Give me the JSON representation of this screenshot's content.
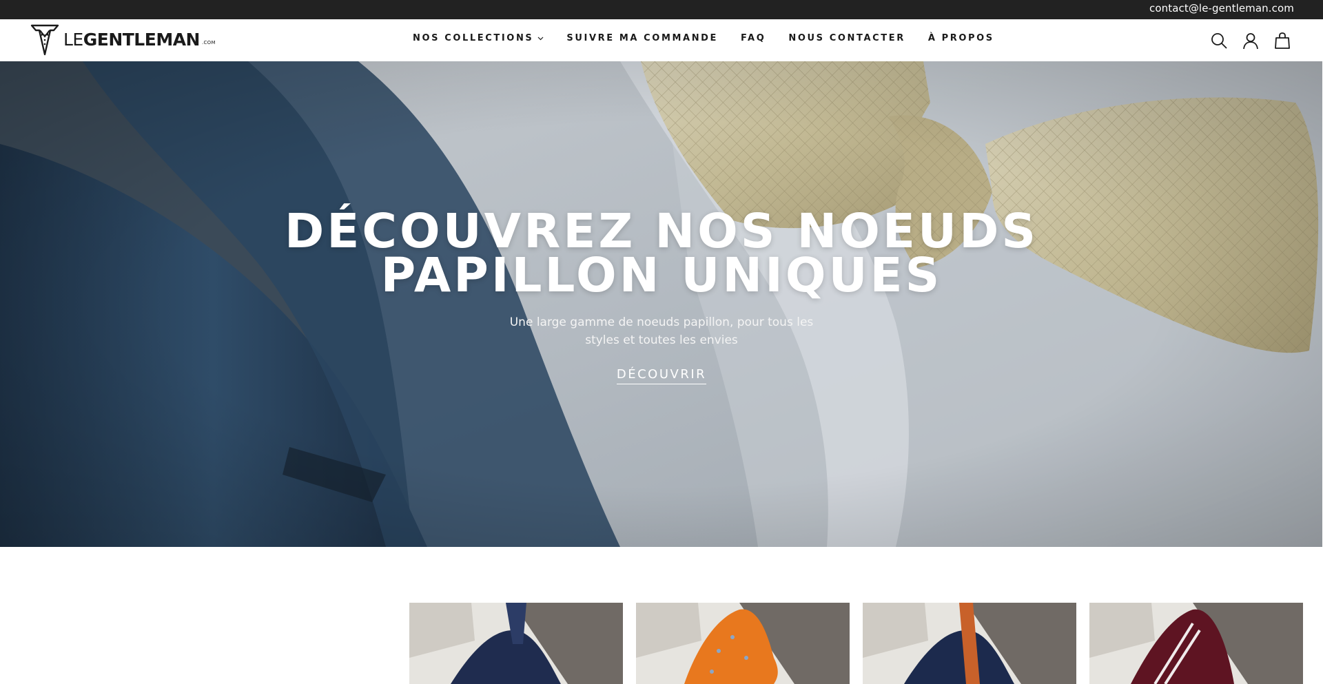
{
  "topbar": {
    "email": "contact@le-gentleman.com"
  },
  "header": {
    "logo": {
      "prefix": "LE",
      "name": "GENTLEMAN",
      "suffix": ".COM"
    },
    "nav": [
      {
        "label": "NOS COLLECTIONS",
        "has_dropdown": true
      },
      {
        "label": "SUIVRE MA COMMANDE"
      },
      {
        "label": "FAQ"
      },
      {
        "label": "NOUS CONTACTER"
      },
      {
        "label": "À PROPOS"
      }
    ],
    "icons": [
      "search-icon",
      "account-icon",
      "cart-icon"
    ]
  },
  "hero": {
    "title_line1": "DÉCOUVREZ NOS NOEUDS",
    "title_line2": "PAPILLON UNIQUES",
    "subtitle": "Une large gamme de noeuds papillon, pour tous les styles et toutes les envies",
    "cta": "DÉCOUVRIR"
  },
  "products": [
    {
      "color": "#1f2c4f",
      "accent": "#2c3c66"
    },
    {
      "color": "#e8781e",
      "accent": "#8aa6c8"
    },
    {
      "color": "#1c2a4d",
      "accent": "#c8612a"
    },
    {
      "color": "#5e1422",
      "accent": "#f0ecec"
    }
  ],
  "colors": {
    "topbar_bg": "#222222",
    "text_dark": "#1a1a1a",
    "hero_text": "#ffffff"
  }
}
